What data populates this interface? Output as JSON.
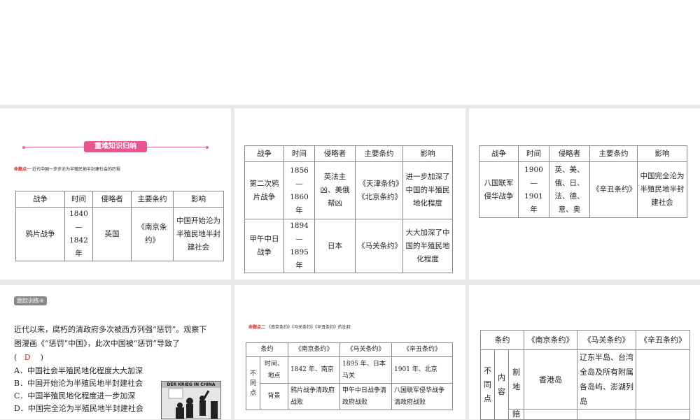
{
  "slide1": {
    "banner": "重难知识归纳",
    "topic_label": "命题点一",
    "topic_text": "近代中国一步步沦为半殖民地半封建社会的历程",
    "headers": [
      "战争",
      "时间",
      "侵略者",
      "主要条约",
      "影响"
    ],
    "rows": [
      [
        "鸦片战争",
        "1840—1842年",
        "英国",
        "《南京条约》",
        "中国开始沦为半殖民地半封建社会"
      ]
    ]
  },
  "slide2": {
    "headers": [
      "战争",
      "时间",
      "侵略者",
      "主要条约",
      "影响"
    ],
    "rows": [
      [
        "第二次鸦片战争",
        "1856—1860年",
        "英法主凶、美俄帮凶",
        "《天津条约》《北京条约》",
        "进一步加深了中国的半殖民地化程度"
      ],
      [
        "甲午中日战争",
        "1894—1895年",
        "日本",
        "《马关条约》",
        "大大加深了中国的半殖民地化程度"
      ]
    ]
  },
  "slide3": {
    "headers": [
      "战争",
      "时间",
      "侵略者",
      "主要条约",
      "影响"
    ],
    "rows": [
      [
        "八国联军侵华战争",
        "1900—1901年",
        "英、美、俄、日、法、德、意、奥",
        "《辛丑条约》",
        "中国完全沦为半殖民地半封建社会"
      ]
    ]
  },
  "slide4": {
    "tag": "跟踪训练④",
    "question": "近代以来，腐朽的清政府多次被西方列强“惩罚”。观察下图漫画《“惩罚”中国》，此次中国被“惩罚”导致了",
    "answer": "D",
    "options": [
      "A．中国社会半殖民地化程度大大加深",
      "B．中国开始沦为半殖民地半封建社会",
      "C．中国半殖民地化程度进一步加深",
      "D．中国完全沦为半殖民地半封建社会"
    ],
    "cartoon_caption": "DER KRIEG IN CHINA"
  },
  "slide5": {
    "topic_label": "命题点二",
    "topic_text": "《南京条约》《马关条约》《辛丑条约》的比较",
    "headers": [
      "条约",
      "《南京条约》",
      "《马关条约》",
      "《辛丑条约》"
    ],
    "group": "不同点",
    "rows": [
      [
        "时间、地点",
        "1842 年、南京",
        "1895 年、日本马关",
        "1901 年、北京"
      ],
      [
        "背景",
        "鸦片战争清政府战败",
        "甲午中日战争清政府战败",
        "八国联军侵华战争清政府战败"
      ]
    ]
  },
  "slide6": {
    "headers": [
      "条约",
      "《南京条约》",
      "《马关条约》",
      "《辛丑条约》"
    ],
    "group": "不同点",
    "sub": "内容",
    "rows": [
      [
        "割地",
        "香港岛",
        "辽东半岛、台湾全岛及所有附属各岛屿、澎湖列岛",
        ""
      ],
      [
        "赔",
        "",
        "",
        ""
      ]
    ]
  }
}
